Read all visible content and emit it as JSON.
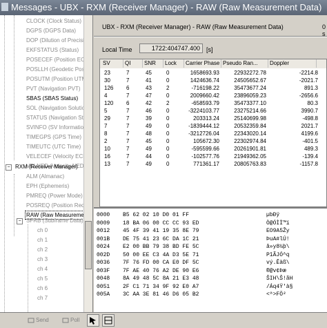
{
  "window": {
    "title": "Messages - UBX - RXM (Receiver Manager) - RAW (Raw Measurement Data)"
  },
  "tree": {
    "items": [
      {
        "label": "CLOCK (Clock Status)"
      },
      {
        "label": "DGPS (DGPS Data)"
      },
      {
        "label": "DOP (Dilution of Precision)"
      },
      {
        "label": "EKFSTATUS (Status)"
      },
      {
        "label": "POSECEF (Position ECEF)"
      },
      {
        "label": "POSLLH (Geodetic Position)"
      },
      {
        "label": "POSUTM (Position UTM)"
      },
      {
        "label": "PVT (Navigation PVT)"
      },
      {
        "label": "SBAS (SBAS Status)"
      },
      {
        "label": "SOL (Navigation Solution)"
      },
      {
        "label": "STATUS (Navigation Status)"
      },
      {
        "label": "SVINFO (SV Information)"
      },
      {
        "label": "TIMEGPS (GPS Time)"
      },
      {
        "label": "TIMEUTC (UTC Time)"
      },
      {
        "label": "VELECEF (Velocity ECEF)"
      },
      {
        "label": "VELNED (Velocity NED)"
      },
      {
        "label": "RXM (Receiver Manager)"
      },
      {
        "label": "ALM (Almanac)"
      },
      {
        "label": "EPH (Ephemeris)"
      },
      {
        "label": "PMREQ (Power Mode)"
      },
      {
        "label": "POSREQ (Position Request)"
      },
      {
        "label": "RAW (Raw Measurement Data)"
      },
      {
        "label": "SFRB (Subframe Data)"
      },
      {
        "label": "ch 0"
      },
      {
        "label": "ch 1"
      },
      {
        "label": "ch 2"
      },
      {
        "label": "ch 3"
      },
      {
        "label": "ch 4"
      },
      {
        "label": "ch 5"
      },
      {
        "label": "ch 6"
      },
      {
        "label": "ch 7"
      }
    ],
    "expander_minus": "−",
    "expander_plus": "+"
  },
  "panel": {
    "title": "UBX - RXM (Receiver Manager) - RAW (Raw Measurement Data)",
    "extra": "0 s",
    "local_time_label": "Local Time",
    "local_time_value": "1722:404747.400",
    "local_time_unit": "[s]"
  },
  "table": {
    "headers": [
      "SV",
      "QI",
      "SNR",
      "Lock",
      "Carrier Phase",
      "Pseudo Ran...",
      "Doppler"
    ],
    "rows": [
      [
        "23",
        "7",
        "45",
        "0",
        "1658693.93",
        "22932272.78",
        "-2214.8"
      ],
      [
        "30",
        "7",
        "41",
        "0",
        "1424636.74",
        "24505652.67",
        "-2021.7"
      ],
      [
        "126",
        "6",
        "43",
        "2",
        "-716198.22",
        "35473677.24",
        "891.3"
      ],
      [
        "4",
        "7",
        "47",
        "0",
        "2009660.42",
        "23896059.23",
        "-2656.6"
      ],
      [
        "120",
        "6",
        "42",
        "2",
        "-658593.79",
        "35473377.10",
        "80.3"
      ],
      [
        "5",
        "7",
        "46",
        "0",
        "-3224103.77",
        "23275214.66",
        "3990.7"
      ],
      [
        "29",
        "7",
        "39",
        "0",
        "203313.24",
        "25140699.98",
        "-498.8"
      ],
      [
        "7",
        "7",
        "49",
        "0",
        "-1839444.12",
        "20532359.84",
        "2021.7"
      ],
      [
        "8",
        "7",
        "48",
        "0",
        "-3212726.04",
        "22343020.14",
        "4199.6"
      ],
      [
        "2",
        "7",
        "45",
        "0",
        "105672.30",
        "22302974.84",
        "-401.5"
      ],
      [
        "10",
        "7",
        "49",
        "0",
        "-595599.66",
        "20261901.81",
        "489.3"
      ],
      [
        "16",
        "7",
        "44",
        "0",
        "-102577.76",
        "21949362.05",
        "-139.4"
      ],
      [
        "13",
        "7",
        "49",
        "0",
        "771361.17",
        "20805763.83",
        "-1157.8"
      ]
    ]
  },
  "hex": {
    "rows": [
      {
        "addr": "0000",
        "bytes": "B5 62 02 10 D0 01 FF",
        "ascii": "µbÐÿ"
      },
      {
        "addr": "0009",
        "bytes": "18 BA 06 00 CC CC 93 ED",
        "ascii": "Ò@ÓÌÌ™í"
      },
      {
        "addr": "0012",
        "bytes": "45 4F 39 41 19 35 8E 79",
        "ascii": "EO9A5Žy"
      },
      {
        "addr": "001B",
        "bytes": "DE 75 41 23 6C DA 1C 21",
        "ascii": "ÞuA#lÚ!"
      },
      {
        "addr": "0024",
        "bytes": "E2 00 BB 79 38 BD FE 5C",
        "ascii": "â»y8½þ\\"
      },
      {
        "addr": "002D",
        "bytes": "50 00 EE C3 4A D3 5E 71",
        "ascii": "PîÃJÓ^q"
      },
      {
        "addr": "0036",
        "bytes": "7F 76 FD 00 CA E0 DF 5C",
        "ascii": "vý.Êàß\\"
      },
      {
        "addr": "003F",
        "bytes": "7F AE 40 76 A2 DE 90 E6",
        "ascii": "®@v¢Þæ"
      },
      {
        "addr": "0048",
        "bytes": "8A 49 48 5C 8A 21 E3 48",
        "ascii": "ŠIH\\Š!ãH"
      },
      {
        "addr": "0051",
        "bytes": "2F C1 71 34 9F 92 E0 A7",
        "ascii": "/Áq4Ÿ'à§"
      },
      {
        "addr": "005A",
        "bytes": "3C AA 3E 81 46 D6 05 B2",
        "ascii": "<ª>FÖ²"
      }
    ]
  },
  "bottombar": {
    "send_label": "Send",
    "poll_label": "Poll"
  },
  "colors": {
    "title_bg": "#6a7585",
    "window_bg": "#d4d0c8",
    "greyed_text": "#8a8a8a"
  }
}
